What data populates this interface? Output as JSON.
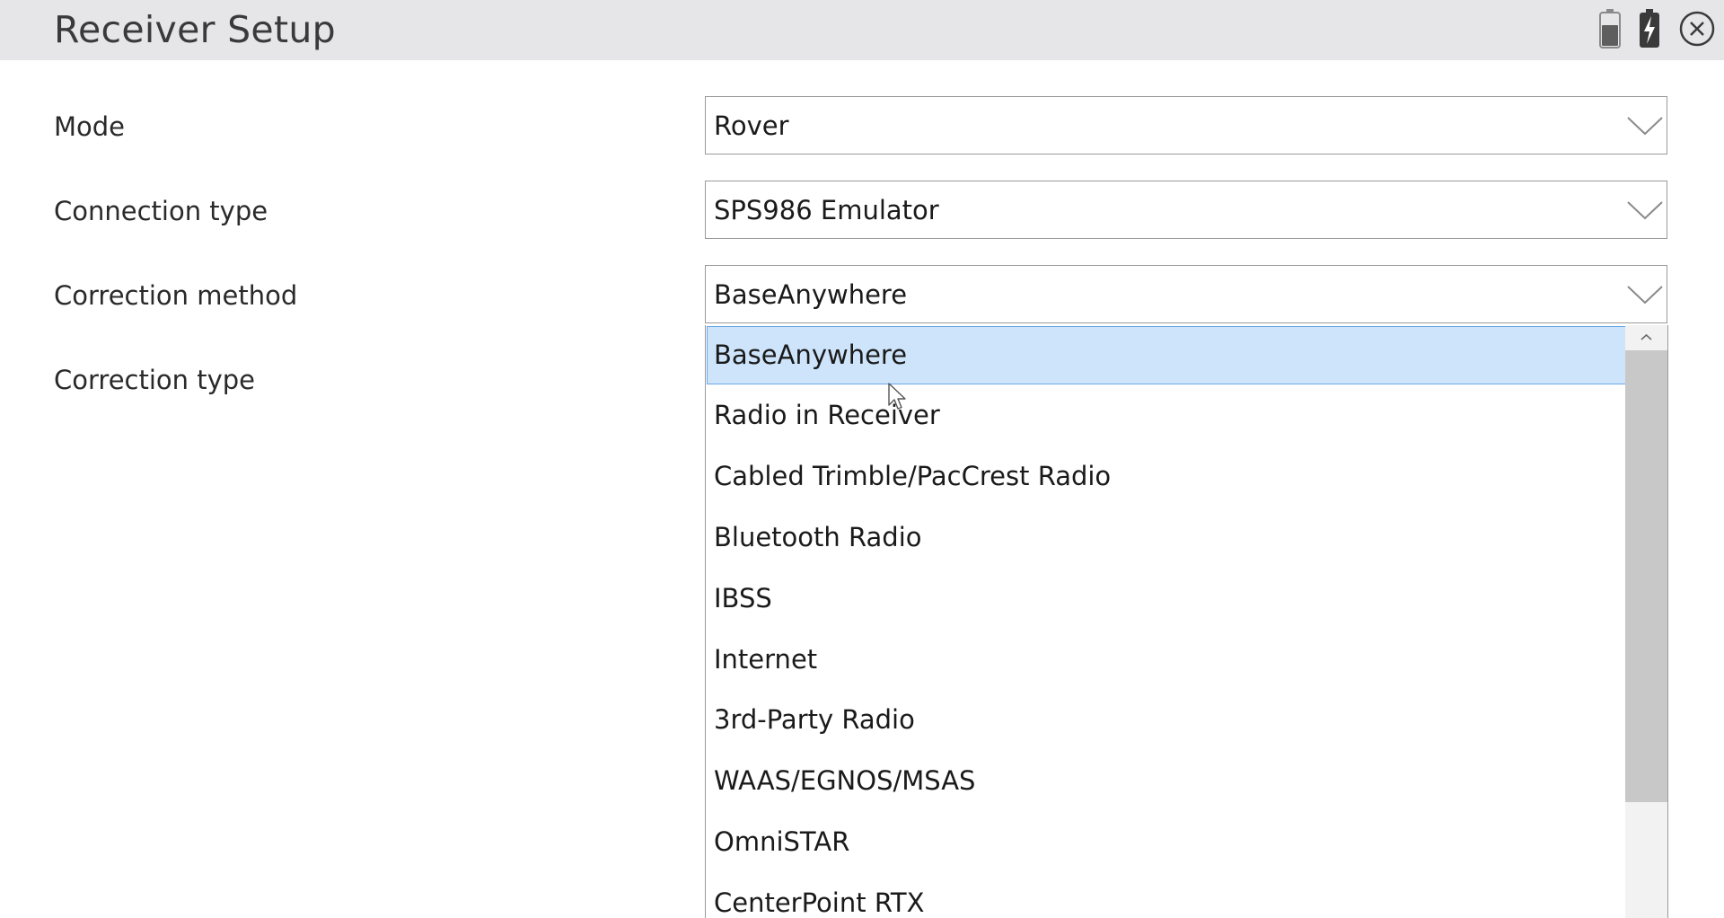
{
  "window": {
    "title": "Receiver Setup",
    "icons": [
      "battery-icon",
      "battery-charging-icon",
      "close-icon"
    ]
  },
  "form": {
    "mode": {
      "label": "Mode",
      "value": "Rover"
    },
    "connection_type": {
      "label": "Connection type",
      "value": "SPS986 Emulator"
    },
    "correction_method": {
      "label": "Correction method",
      "value": "BaseAnywhere"
    },
    "correction_type": {
      "label": "Correction type"
    }
  },
  "dropdown": {
    "options": [
      "BaseAnywhere",
      "Radio in Receiver",
      "Cabled Trimble/PacCrest Radio",
      "Bluetooth Radio",
      "IBSS",
      "Internet",
      "3rd-Party Radio",
      "WAAS/EGNOS/MSAS",
      "OmniSTAR",
      "CenterPoint RTX"
    ],
    "selected_index": 0
  },
  "colors": {
    "titlebar_bg": "#e6e6e9",
    "selection_bg": "#cde4fb",
    "selection_border": "#6aa7e6",
    "scrollbar_thumb": "#c8c8c8"
  }
}
